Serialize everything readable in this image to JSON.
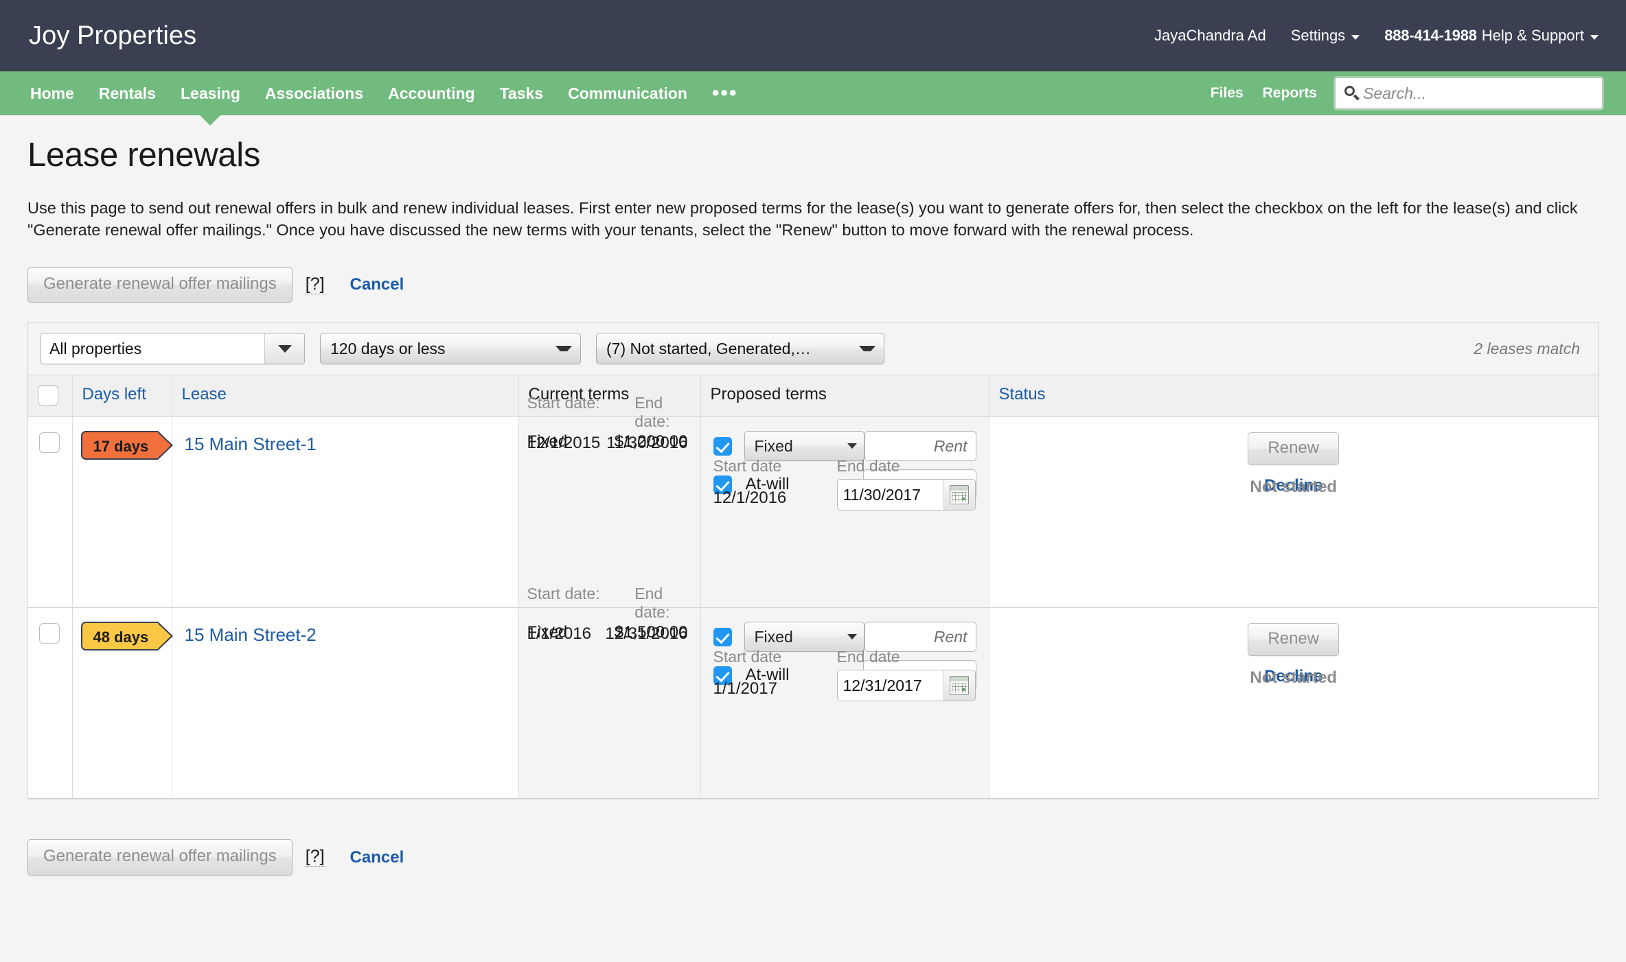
{
  "topbar": {
    "brand": "Joy Properties",
    "user": "JayaChandra Ad",
    "settings": "Settings",
    "phone": "888-414-1988",
    "help": "Help & Support"
  },
  "nav": {
    "items": [
      {
        "label": "Home",
        "active": false
      },
      {
        "label": "Rentals",
        "active": false
      },
      {
        "label": "Leasing",
        "active": true
      },
      {
        "label": "Associations",
        "active": false
      },
      {
        "label": "Accounting",
        "active": false
      },
      {
        "label": "Tasks",
        "active": false
      },
      {
        "label": "Communication",
        "active": false
      }
    ],
    "more": "•••",
    "files": "Files",
    "reports": "Reports",
    "search_placeholder": "Search...",
    "search_value": "",
    "search_icon": "search-icon",
    "accent_green": "#72bb7f",
    "header_dark": "#3a3f51"
  },
  "page": {
    "title": "Lease renewals",
    "description": "Use this page to send out renewal offers in bulk and renew individual leases. First enter new proposed terms for the lease(s) you want to generate offers for, then select the checkbox on the left for the lease(s) and click \"Generate renewal offer mailings.\" Once you have discussed the new terms with your tenants, select the \"Renew\" button to move forward with the renewal process."
  },
  "actions": {
    "generate_label": "Generate renewal offer mailings",
    "help_label": "[?]",
    "cancel_label": "Cancel"
  },
  "filters": {
    "property": {
      "value": "All properties",
      "type": "combobox"
    },
    "days": {
      "value": "120 days or less",
      "type": "select"
    },
    "status": {
      "value": "(7) Not started, Generated,…",
      "type": "select"
    },
    "match_text": "2 leases match"
  },
  "table": {
    "headers": {
      "select_all": "",
      "days_left": "Days left",
      "lease": "Lease",
      "current_terms": "Current terms",
      "proposed_terms": "Proposed terms",
      "status": "Status"
    },
    "rows": [
      {
        "checked": false,
        "days_badge": "17 days",
        "badge_color": "#f2703c",
        "lease": "15 Main Street-1",
        "current": {
          "type": "Fixed",
          "amount": "$1,200.00",
          "start_label": "Start date:",
          "end_label": "End date:",
          "start": "12/1/2015",
          "end": "11/30/2016"
        },
        "proposed": {
          "fixed_checked": true,
          "term_select": "Fixed",
          "rent_placeholder_1": "Rent",
          "rent_value_1": "",
          "atwill_checked": true,
          "atwill_label": "At-will",
          "rent_placeholder_2": "Rent",
          "rent_value_2": "",
          "start_label": "Start date",
          "end_label": "End date",
          "start": "12/1/2016",
          "end": "11/30/2017"
        },
        "status": {
          "renew_label": "Renew",
          "decline_label": "Decline",
          "state": "Not started"
        }
      },
      {
        "checked": false,
        "days_badge": "48 days",
        "badge_color": "#fbc845",
        "lease": "15 Main Street-2",
        "current": {
          "type": "Fixed",
          "amount": "$1,500.00",
          "start_label": "Start date:",
          "end_label": "End date:",
          "start": "1/1/2016",
          "end": "12/31/2016"
        },
        "proposed": {
          "fixed_checked": true,
          "term_select": "Fixed",
          "rent_placeholder_1": "Rent",
          "rent_value_1": "",
          "atwill_checked": true,
          "atwill_label": "At-will",
          "rent_placeholder_2": "Rent",
          "rent_value_2": "",
          "start_label": "Start date",
          "end_label": "End date",
          "start": "1/1/2017",
          "end": "12/31/2017"
        },
        "status": {
          "renew_label": "Renew",
          "decline_label": "Decline",
          "state": "Not started"
        }
      }
    ]
  }
}
